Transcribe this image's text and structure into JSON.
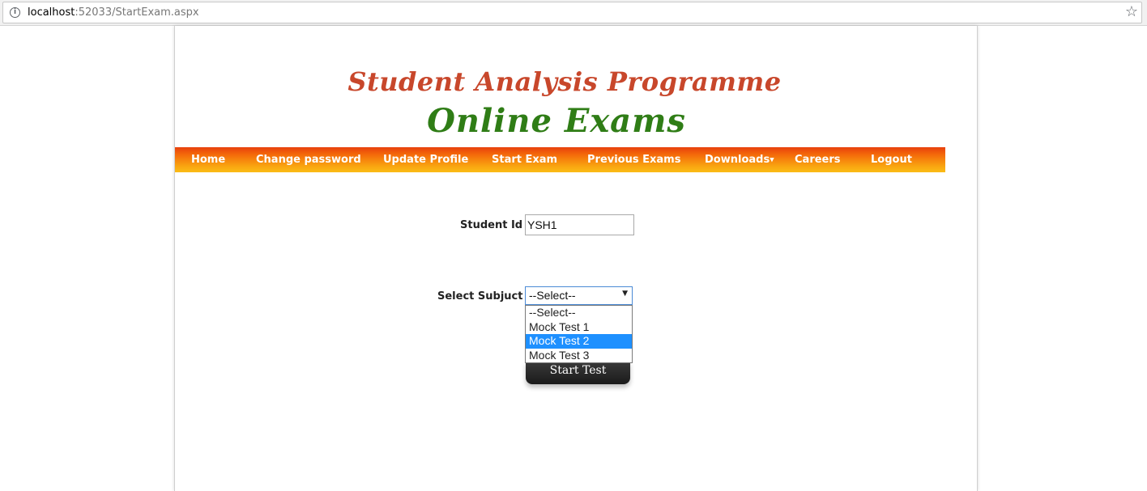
{
  "browser": {
    "url_host": "localhost",
    "url_rest": ":52033/StartExam.aspx",
    "info_glyph": "i",
    "star_glyph": "☆"
  },
  "header": {
    "title": "Student Analysis Programme",
    "subtitle": "Online Exams"
  },
  "nav": {
    "items": [
      {
        "label": "Home"
      },
      {
        "label": "Change password"
      },
      {
        "label": "Update Profile"
      },
      {
        "label": "Start Exam"
      },
      {
        "label": "Previous Exams"
      },
      {
        "label": "Downloads",
        "caret": "▼"
      },
      {
        "label": "Careers"
      },
      {
        "label": "Logout"
      }
    ]
  },
  "form": {
    "student_id_label": "Student Id :",
    "student_id_value": "YSH1",
    "subject_label": "Select Subjuct :",
    "subject_selected": "--Select--",
    "subject_arrow": "▼",
    "options": [
      "--Select--",
      "Mock Test 1",
      "Mock Test 2",
      "Mock Test 3"
    ],
    "highlighted_option": "Mock Test 2",
    "start_button_label": "Start Test"
  },
  "colors": {
    "title": "#c8472b",
    "subtitle": "#2f7d16",
    "nav_top": "#e8400c",
    "nav_bottom": "#fbbd16",
    "option_highlight": "#1e90ff"
  }
}
